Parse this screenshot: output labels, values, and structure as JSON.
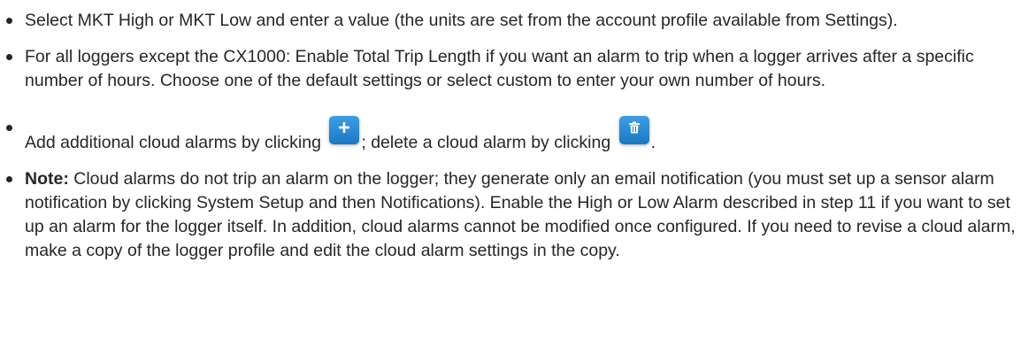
{
  "bullets": {
    "item1": "Select MKT High or MKT Low and enter a value (the units are set from the account profile available from Settings).",
    "item2": "For all loggers except the CX1000: Enable Total Trip Length if you want an alarm to trip when a logger arrives after a specific number of hours. Choose one of the default settings or select custom to enter your own number of hours.",
    "item3": {
      "part1": "Add additional cloud alarms by clicking ",
      "part2": "; delete a cloud alarm by clicking ",
      "part3": ".",
      "add_icon": "plus-icon",
      "delete_icon": "trash-icon"
    },
    "item4": {
      "label": "Note:",
      "text": " Cloud alarms do not trip an alarm on the logger; they generate only an email notification (you must set up a sensor alarm notification by clicking System Setup and then Notifications). Enable the High or Low Alarm described in step 11 if you want to set up an alarm for the logger itself. In addition, cloud alarms cannot be modified once configured. If you need to revise a cloud alarm, make a copy of the logger profile and edit the cloud alarm settings in the copy."
    }
  },
  "colors": {
    "text": "#262626",
    "icon_button": "#2a8bd6"
  }
}
